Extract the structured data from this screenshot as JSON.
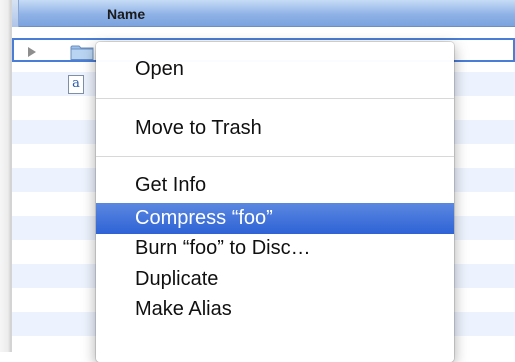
{
  "column_header": {
    "name_label": "Name"
  },
  "files": [
    {
      "type": "folder",
      "name": "foo",
      "selected": true
    },
    {
      "type": "document",
      "icon_letter": "a",
      "name": ""
    }
  ],
  "context_menu": {
    "items": [
      {
        "label": "Open",
        "group": 1
      },
      {
        "label": "Move to Trash",
        "group": 2
      },
      {
        "label": "Get Info",
        "group": 3
      },
      {
        "label": "Compress “foo”",
        "group": 3,
        "highlighted": true
      },
      {
        "label": "Burn “foo” to Disc…",
        "group": 3
      },
      {
        "label": "Duplicate",
        "group": 3
      },
      {
        "label": "Make Alias",
        "group": 3
      }
    ]
  },
  "colors": {
    "header_blue": "#8fb2e6",
    "row_stripe": "#edf3fe",
    "selection_border": "#4a7ed6",
    "menu_highlight": "#2f62d6"
  }
}
